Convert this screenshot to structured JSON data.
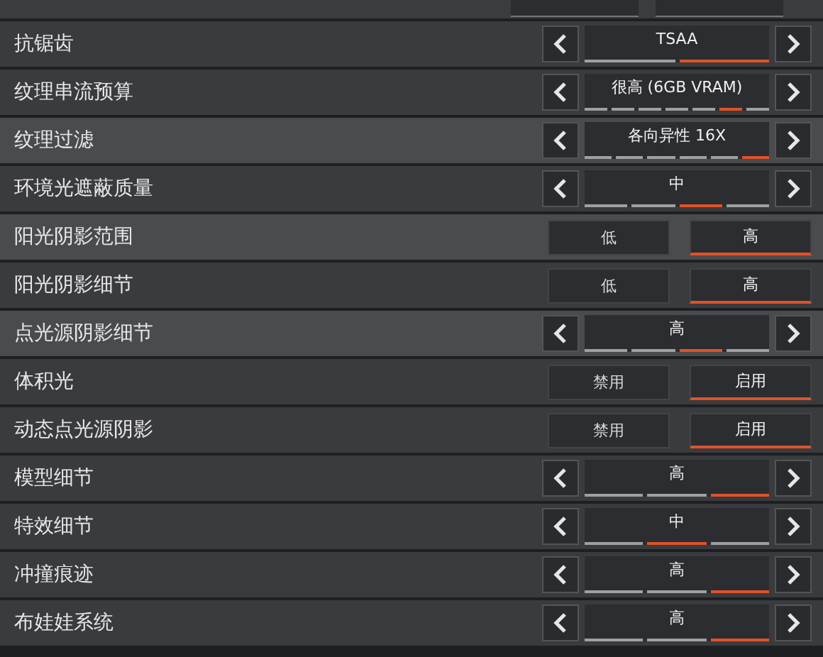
{
  "settings": [
    {
      "label": "抗锯齿",
      "kind": "cycle",
      "value": "TSAA",
      "highlighted": false,
      "segments": [
        {
          "selected": false
        },
        {
          "selected": true
        }
      ]
    },
    {
      "label": "纹理串流预算",
      "kind": "cycle",
      "value": "很高 (6GB VRAM)",
      "highlighted": false,
      "segments": [
        {
          "selected": false
        },
        {
          "selected": false
        },
        {
          "selected": false
        },
        {
          "selected": false
        },
        {
          "selected": false
        },
        {
          "selected": true
        },
        {
          "selected": false
        }
      ]
    },
    {
      "label": "纹理过滤",
      "kind": "cycle",
      "value": "各向异性 16X",
      "highlighted": true,
      "segments": [
        {
          "selected": false
        },
        {
          "selected": false
        },
        {
          "selected": false
        },
        {
          "selected": false
        },
        {
          "selected": false
        },
        {
          "selected": true
        }
      ]
    },
    {
      "label": "环境光遮蔽质量",
      "kind": "cycle",
      "value": "中",
      "highlighted": false,
      "segments": [
        {
          "selected": false
        },
        {
          "selected": false
        },
        {
          "selected": true
        },
        {
          "selected": false
        }
      ]
    },
    {
      "label": "阳光阴影范围",
      "kind": "toggle",
      "highlighted": true,
      "options": [
        {
          "label": "低",
          "selected": false
        },
        {
          "label": "高",
          "selected": true
        }
      ]
    },
    {
      "label": "阳光阴影细节",
      "kind": "toggle",
      "highlighted": false,
      "options": [
        {
          "label": "低",
          "selected": false
        },
        {
          "label": "高",
          "selected": true
        }
      ]
    },
    {
      "label": "点光源阴影细节",
      "kind": "cycle",
      "value": "高",
      "highlighted": true,
      "segments": [
        {
          "selected": false
        },
        {
          "selected": false
        },
        {
          "selected": true
        },
        {
          "selected": false
        }
      ]
    },
    {
      "label": "体积光",
      "kind": "toggle",
      "highlighted": false,
      "options": [
        {
          "label": "禁用",
          "selected": false
        },
        {
          "label": "启用",
          "selected": true
        }
      ]
    },
    {
      "label": "动态点光源阴影",
      "kind": "toggle",
      "highlighted": false,
      "options": [
        {
          "label": "禁用",
          "selected": false
        },
        {
          "label": "启用",
          "selected": true
        }
      ]
    },
    {
      "label": "模型细节",
      "kind": "cycle",
      "value": "高",
      "highlighted": false,
      "segments": [
        {
          "selected": false
        },
        {
          "selected": false
        },
        {
          "selected": true
        }
      ]
    },
    {
      "label": "特效细节",
      "kind": "cycle",
      "value": "中",
      "highlighted": false,
      "segments": [
        {
          "selected": false
        },
        {
          "selected": true
        },
        {
          "selected": false
        }
      ]
    },
    {
      "label": "冲撞痕迹",
      "kind": "cycle",
      "value": "高",
      "highlighted": false,
      "segments": [
        {
          "selected": false
        },
        {
          "selected": false
        },
        {
          "selected": true
        }
      ]
    },
    {
      "label": "布娃娃系统",
      "kind": "cycle",
      "value": "高",
      "highlighted": false,
      "segments": [
        {
          "selected": false
        },
        {
          "selected": false
        },
        {
          "selected": true
        }
      ]
    }
  ]
}
